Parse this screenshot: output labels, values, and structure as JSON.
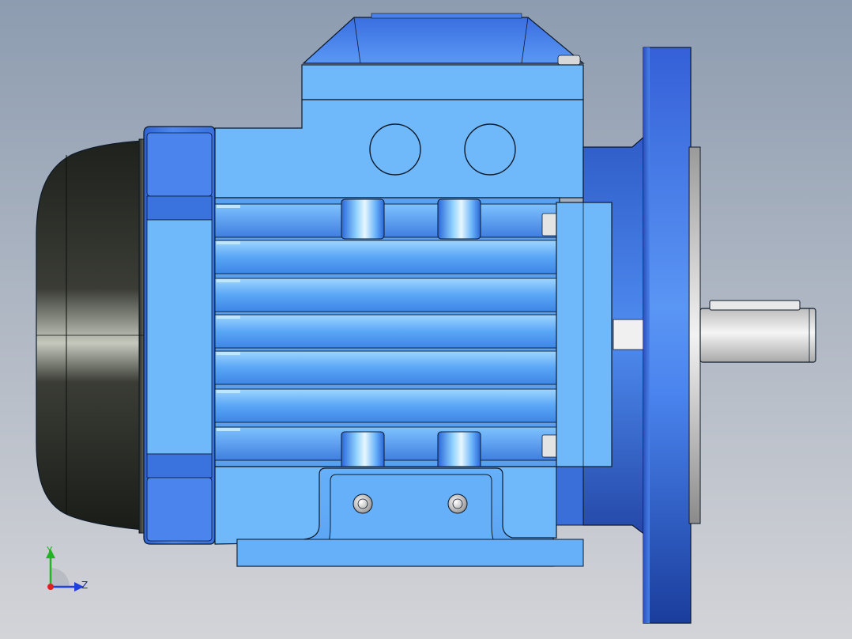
{
  "viewport": {
    "background_top": "#8d9cb0",
    "background_bottom": "#d3d4d8"
  },
  "model": {
    "part": "electric-motor-flange-mount",
    "colors": {
      "housing_light": "#6fb9fb",
      "housing_mid": "#5aa0ee",
      "housing_dark": "#2f62d2",
      "end_shield": "#3f74e0",
      "flange": "#3b6ee0",
      "flange_dark": "#1a3d9c",
      "fan_cover_dark": "#1e211c",
      "fan_cover_light": "#c4c8bd",
      "shaft": "#e6e6e6",
      "outline": "#0d1a2a"
    }
  },
  "triad": {
    "y_label": "Y",
    "z_label": "Z",
    "y_color": "#22b422",
    "z_color": "#2040e0",
    "origin_color": "#e02020"
  }
}
